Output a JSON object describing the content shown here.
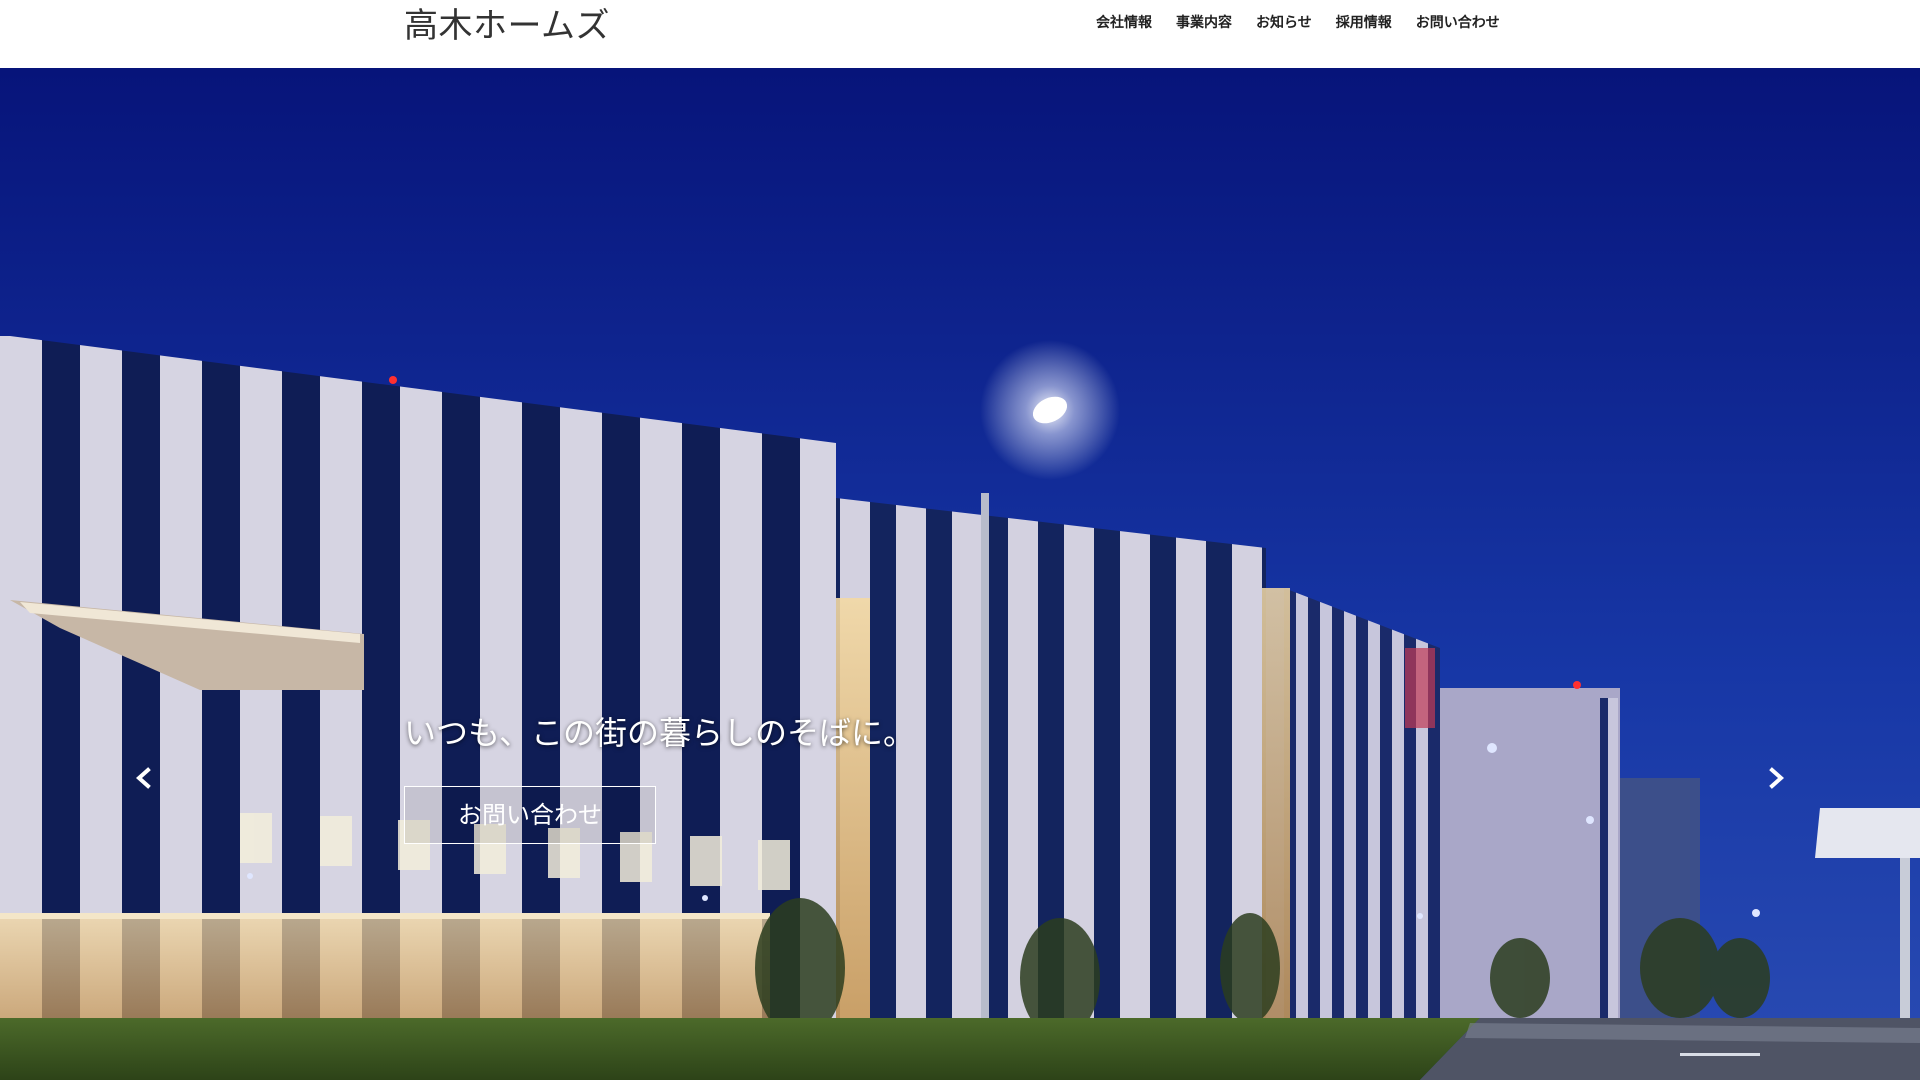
{
  "header": {
    "brand": "高木ホームズ",
    "nav": [
      {
        "label": "会社情報"
      },
      {
        "label": "事業内容"
      },
      {
        "label": "お知らせ"
      },
      {
        "label": "採用情報"
      },
      {
        "label": "お問い合わせ"
      }
    ]
  },
  "hero": {
    "headline": "いつも、この街の暮らしのそばに。",
    "cta_label": "お問い合わせ",
    "background_image": "night-building-photo",
    "prev_icon": "chevron-left-icon",
    "next_icon": "chevron-right-icon"
  },
  "colors": {
    "sky_top": "#0a1f8a",
    "sky_bottom": "#1e3aa8",
    "building": "#c9c7d8",
    "window_dark": "#0c1a4a",
    "grass": "#3f5a24",
    "road": "#6b6e7a"
  }
}
